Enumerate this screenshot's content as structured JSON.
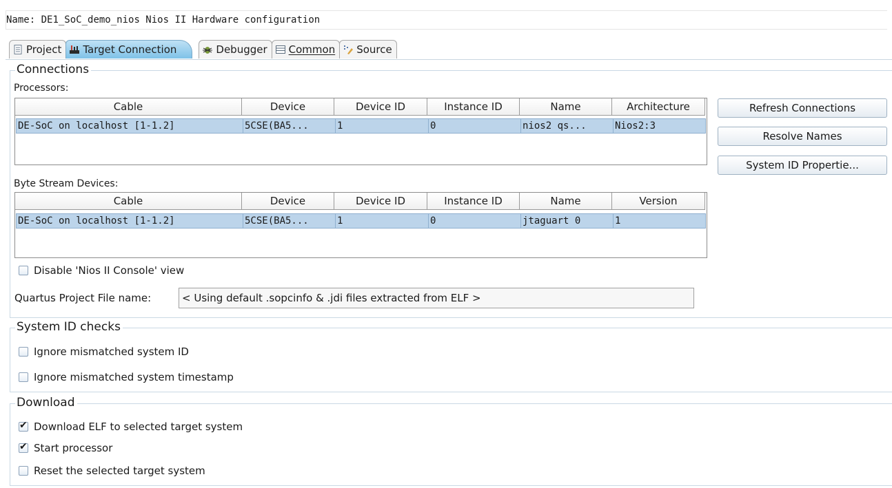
{
  "header": {
    "name_label": "Name:",
    "name_value": "DE1_SoC_demo_nios Nios II Hardware configuration"
  },
  "tabs": [
    {
      "label": "Project",
      "icon": "document-icon",
      "active": false
    },
    {
      "label": "Target Connection",
      "icon": "board-icon",
      "active": true
    },
    {
      "label": "Debugger",
      "icon": "bug-icon",
      "active": false
    },
    {
      "label": "Common",
      "icon": "list-icon",
      "active": false
    },
    {
      "label": "Source",
      "icon": "source-icon",
      "active": false
    }
  ],
  "connections": {
    "title": "Connections",
    "processors_label": "Processors:",
    "processors_columns": [
      "Cable",
      "Device",
      "Device ID",
      "Instance ID",
      "Name",
      "Architecture"
    ],
    "processors_rows": [
      [
        "DE-SoC on localhost [1-1.2]",
        "5CSE(BA5...",
        "1",
        "0",
        "nios2 qs...",
        "Nios2:3"
      ]
    ],
    "byte_stream_label": "Byte Stream Devices:",
    "byte_stream_columns": [
      "Cable",
      "Device",
      "Device ID",
      "Instance ID",
      "Name",
      "Version"
    ],
    "byte_stream_rows": [
      [
        "DE-SoC on localhost [1-1.2]",
        "5CSE(BA5...",
        "1",
        "0",
        "jtaguart 0",
        "1"
      ]
    ],
    "buttons": {
      "refresh": "Refresh Connections",
      "resolve": "Resolve Names",
      "sysid": "System ID Propertie..."
    },
    "disable_console_label": "Disable 'Nios II Console' view",
    "disable_console_checked": false,
    "qpf_label": "Quartus Project File name:",
    "qpf_value": "< Using default .sopcinfo & .jdi files extracted from ELF >"
  },
  "system_id": {
    "title": "System ID checks",
    "ignore_id_label": "Ignore mismatched system ID",
    "ignore_id_checked": false,
    "ignore_ts_label": "Ignore mismatched system timestamp",
    "ignore_ts_checked": false
  },
  "download": {
    "title": "Download",
    "download_elf_label": "Download ELF to selected target system",
    "download_elf_checked": true,
    "start_processor_label": "Start processor",
    "start_processor_checked": true,
    "reset_label": "Reset the selected target system",
    "reset_checked": false
  },
  "colors": {
    "selection_row": "#bcd4ea",
    "active_tab": "#7fc2e8"
  }
}
